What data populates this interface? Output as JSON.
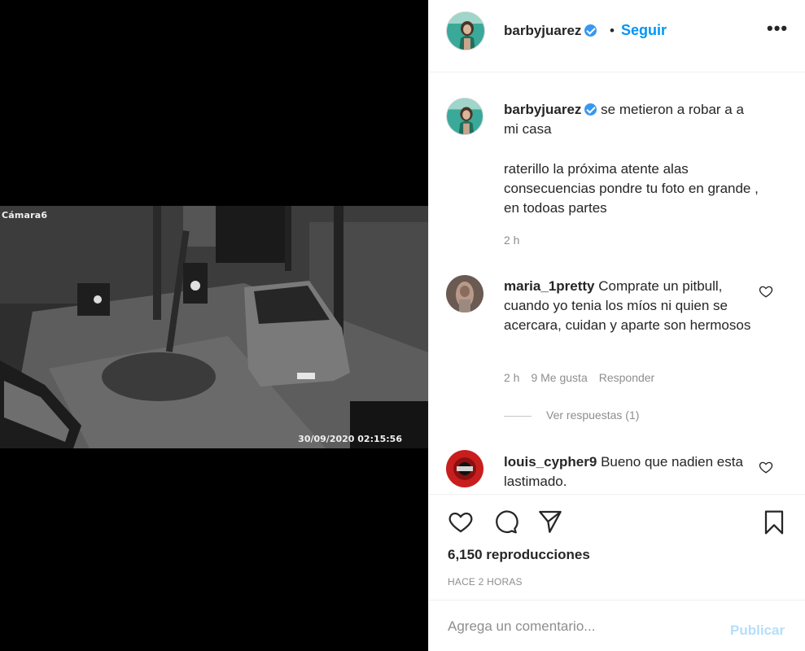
{
  "media": {
    "camera_label": "Cámara6",
    "timestamp": "30/09/2020 02:15:56"
  },
  "header": {
    "username": "barbyjuarez",
    "dot": "•",
    "follow_label": "Seguir",
    "more_icon": "more-options-icon"
  },
  "caption": {
    "username": "barbyjuarez",
    "line1": "se metieron a robar a a mi casa",
    "line2": "raterillo la próxima atente alas consecuencias pondre tu foto en grande , en todoas partes",
    "time": "2 h"
  },
  "comments": [
    {
      "username": "maria_1pretty",
      "text": "Comprate un pitbull, cuando yo tenia los míos ni quien se acercara, cuidan y aparte son hermosos",
      "time": "2 h",
      "likes": "9 Me gusta",
      "reply": "Responder",
      "view_replies": "Ver respuestas (1)"
    },
    {
      "username": "louis_cypher9",
      "text": "Bueno que nadien esta lastimado."
    }
  ],
  "actions": {
    "views": "6,150 reproducciones",
    "time_ago": "HACE 2 HORAS"
  },
  "add_comment": {
    "placeholder": "Agrega un comentario...",
    "publish_label": "Publicar"
  },
  "colors": {
    "accent": "#0095f6",
    "verified": "#3897f0",
    "publish_disabled": "#b2dffc",
    "muted": "#8e8e8e"
  }
}
